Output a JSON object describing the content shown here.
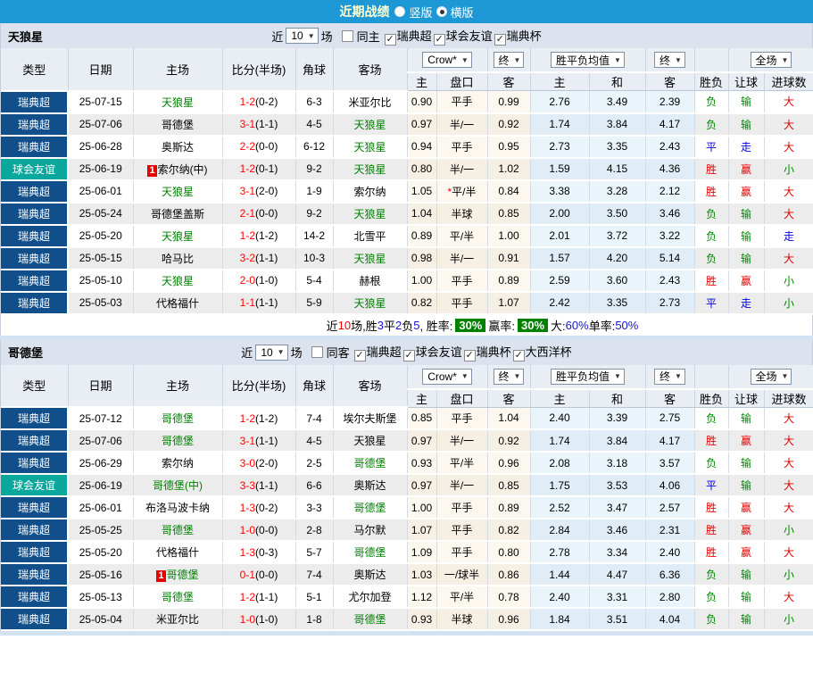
{
  "title_bar": {
    "title": "近期战绩",
    "options": [
      {
        "label": "竖版",
        "selected": false
      },
      {
        "label": "横版",
        "selected": true
      }
    ]
  },
  "filter_common": {
    "near_label": "近",
    "count": "10",
    "matches_label": "场"
  },
  "header": {
    "left_columns": [
      "类型",
      "日期",
      "主场",
      "比分(半场)",
      "角球",
      "客场"
    ],
    "groups": {
      "handicap_dropdown": "Crow*",
      "handicap_final": "终",
      "avg_dropdown": "胜平负均值",
      "avg_final": "终",
      "scope_dropdown": "全场"
    },
    "sub_columns": [
      "主",
      "盘口",
      "客",
      "主",
      "和",
      "客",
      "胜负",
      "让球",
      "进球数"
    ]
  },
  "result_colors": {
    "胜": "red",
    "赢": "red",
    "大": "red",
    "平": "blue",
    "走": "blue",
    "负": "green",
    "输": "green",
    "小": "green"
  },
  "colors": {
    "title_bar_blue": "#1e97d5",
    "league_navy": "#114f8b",
    "friendly_teal": "#0aa79d",
    "focus_team_green": "#008000",
    "score_red": "#ff0000",
    "rate_badge_green": "#008000"
  },
  "sections": [
    {
      "team": "天狼星",
      "same_option": {
        "label": "同主",
        "checked": false
      },
      "leagues": [
        {
          "label": "瑞典超",
          "checked": true
        },
        {
          "label": "球会友谊",
          "checked": true
        },
        {
          "label": "瑞典杯",
          "checked": true
        }
      ],
      "rows": [
        {
          "type": "瑞典超",
          "type_style": "league",
          "date": "25-07-15",
          "home": "天狼星",
          "home_focus": true,
          "home_badge": "",
          "score": "1-2",
          "half": "(0-2)",
          "corner": "6-3",
          "away": "米亚尔比",
          "away_focus": false,
          "odds": [
            "0.90",
            "平手",
            "0.99"
          ],
          "star": false,
          "avg": [
            "2.76",
            "3.49",
            "2.39"
          ],
          "results": [
            "负",
            "输",
            "大"
          ]
        },
        {
          "type": "瑞典超",
          "type_style": "league",
          "date": "25-07-06",
          "home": "哥德堡",
          "home_focus": false,
          "home_badge": "",
          "score": "3-1",
          "half": "(1-1)",
          "corner": "4-5",
          "away": "天狼星",
          "away_focus": true,
          "odds": [
            "0.97",
            "半/一",
            "0.92"
          ],
          "star": false,
          "avg": [
            "1.74",
            "3.84",
            "4.17"
          ],
          "results": [
            "负",
            "输",
            "大"
          ]
        },
        {
          "type": "瑞典超",
          "type_style": "league",
          "date": "25-06-28",
          "home": "奥斯达",
          "home_focus": false,
          "home_badge": "",
          "score": "2-2",
          "half": "(0-0)",
          "corner": "6-12",
          "away": "天狼星",
          "away_focus": true,
          "odds": [
            "0.94",
            "平手",
            "0.95"
          ],
          "star": false,
          "avg": [
            "2.73",
            "3.35",
            "2.43"
          ],
          "results": [
            "平",
            "走",
            "大"
          ]
        },
        {
          "type": "球会友谊",
          "type_style": "friendly",
          "date": "25-06-19",
          "home": "索尔纳(中)",
          "home_focus": false,
          "home_badge": "1",
          "score": "1-2",
          "half": "(0-1)",
          "corner": "9-2",
          "away": "天狼星",
          "away_focus": true,
          "odds": [
            "0.80",
            "半/一",
            "1.02"
          ],
          "star": false,
          "avg": [
            "1.59",
            "4.15",
            "4.36"
          ],
          "results": [
            "胜",
            "赢",
            "小"
          ]
        },
        {
          "type": "瑞典超",
          "type_style": "league",
          "date": "25-06-01",
          "home": "天狼星",
          "home_focus": true,
          "home_badge": "",
          "score": "3-1",
          "half": "(2-0)",
          "corner": "1-9",
          "away": "索尔纳",
          "away_focus": false,
          "odds": [
            "1.05",
            "平/半",
            "0.84"
          ],
          "star": true,
          "avg": [
            "3.38",
            "3.28",
            "2.12"
          ],
          "results": [
            "胜",
            "赢",
            "大"
          ]
        },
        {
          "type": "瑞典超",
          "type_style": "league",
          "date": "25-05-24",
          "home": "哥德堡盖斯",
          "home_focus": false,
          "home_badge": "",
          "score": "2-1",
          "half": "(0-0)",
          "corner": "9-2",
          "away": "天狼星",
          "away_focus": true,
          "odds": [
            "1.04",
            "半球",
            "0.85"
          ],
          "star": false,
          "avg": [
            "2.00",
            "3.50",
            "3.46"
          ],
          "results": [
            "负",
            "输",
            "大"
          ]
        },
        {
          "type": "瑞典超",
          "type_style": "league",
          "date": "25-05-20",
          "home": "天狼星",
          "home_focus": true,
          "home_badge": "",
          "score": "1-2",
          "half": "(1-2)",
          "corner": "14-2",
          "away": "北雪平",
          "away_focus": false,
          "odds": [
            "0.89",
            "平/半",
            "1.00"
          ],
          "star": false,
          "avg": [
            "2.01",
            "3.72",
            "3.22"
          ],
          "results": [
            "负",
            "输",
            "走"
          ]
        },
        {
          "type": "瑞典超",
          "type_style": "league",
          "date": "25-05-15",
          "home": "哈马比",
          "home_focus": false,
          "home_badge": "",
          "score": "3-2",
          "half": "(1-1)",
          "corner": "10-3",
          "away": "天狼星",
          "away_focus": true,
          "odds": [
            "0.98",
            "半/一",
            "0.91"
          ],
          "star": false,
          "avg": [
            "1.57",
            "4.20",
            "5.14"
          ],
          "results": [
            "负",
            "输",
            "大"
          ]
        },
        {
          "type": "瑞典超",
          "type_style": "league",
          "date": "25-05-10",
          "home": "天狼星",
          "home_focus": true,
          "home_badge": "",
          "score": "2-0",
          "half": "(1-0)",
          "corner": "5-4",
          "away": "赫根",
          "away_focus": false,
          "odds": [
            "1.00",
            "平手",
            "0.89"
          ],
          "star": false,
          "avg": [
            "2.59",
            "3.60",
            "2.43"
          ],
          "results": [
            "胜",
            "赢",
            "小"
          ]
        },
        {
          "type": "瑞典超",
          "type_style": "league",
          "date": "25-05-03",
          "home": "代格福什",
          "home_focus": false,
          "home_badge": "",
          "score": "1-1",
          "half": "(1-1)",
          "corner": "5-9",
          "away": "天狼星",
          "away_focus": true,
          "odds": [
            "0.82",
            "平手",
            "1.07"
          ],
          "star": false,
          "avg": [
            "2.42",
            "3.35",
            "2.73"
          ],
          "results": [
            "平",
            "走",
            "小"
          ]
        }
      ],
      "summary": [
        {
          "t": "近",
          "s": "k"
        },
        {
          "t": "10",
          "s": "r"
        },
        {
          "t": "场,胜",
          "s": "k"
        },
        {
          "t": "3",
          "s": "b"
        },
        {
          "t": "平",
          "s": "k"
        },
        {
          "t": "2",
          "s": "b"
        },
        {
          "t": "负",
          "s": "k"
        },
        {
          "t": "5",
          "s": "b"
        },
        {
          "t": ", 胜率:",
          "s": "k"
        },
        {
          "t": "30%",
          "s": "badge"
        },
        {
          "t": "赢率:",
          "s": "k"
        },
        {
          "t": "30%",
          "s": "badge"
        },
        {
          "t": "大:",
          "s": "k"
        },
        {
          "t": "60%",
          "s": "b"
        },
        {
          "t": " 单率:",
          "s": "k"
        },
        {
          "t": "50%",
          "s": "b"
        }
      ]
    },
    {
      "team": "哥德堡",
      "same_option": {
        "label": "同客",
        "checked": false
      },
      "leagues": [
        {
          "label": "瑞典超",
          "checked": true
        },
        {
          "label": "球会友谊",
          "checked": true
        },
        {
          "label": "瑞典杯",
          "checked": true
        },
        {
          "label": "大西洋杯",
          "checked": true
        }
      ],
      "rows": [
        {
          "type": "瑞典超",
          "type_style": "league",
          "date": "25-07-12",
          "home": "哥德堡",
          "home_focus": true,
          "home_badge": "",
          "score": "1-2",
          "half": "(1-2)",
          "corner": "7-4",
          "away": "埃尔夫斯堡",
          "away_focus": false,
          "odds": [
            "0.85",
            "平手",
            "1.04"
          ],
          "star": false,
          "avg": [
            "2.40",
            "3.39",
            "2.75"
          ],
          "results": [
            "负",
            "输",
            "大"
          ]
        },
        {
          "type": "瑞典超",
          "type_style": "league",
          "date": "25-07-06",
          "home": "哥德堡",
          "home_focus": true,
          "home_badge": "",
          "score": "3-1",
          "half": "(1-1)",
          "corner": "4-5",
          "away": "天狼星",
          "away_focus": false,
          "odds": [
            "0.97",
            "半/一",
            "0.92"
          ],
          "star": false,
          "avg": [
            "1.74",
            "3.84",
            "4.17"
          ],
          "results": [
            "胜",
            "赢",
            "大"
          ]
        },
        {
          "type": "瑞典超",
          "type_style": "league",
          "date": "25-06-29",
          "home": "索尔纳",
          "home_focus": false,
          "home_badge": "",
          "score": "3-0",
          "half": "(2-0)",
          "corner": "2-5",
          "away": "哥德堡",
          "away_focus": true,
          "odds": [
            "0.93",
            "平/半",
            "0.96"
          ],
          "star": false,
          "avg": [
            "2.08",
            "3.18",
            "3.57"
          ],
          "results": [
            "负",
            "输",
            "大"
          ]
        },
        {
          "type": "球会友谊",
          "type_style": "friendly",
          "date": "25-06-19",
          "home": "哥德堡(中)",
          "home_focus": true,
          "home_badge": "",
          "score": "3-3",
          "half": "(1-1)",
          "corner": "6-6",
          "away": "奥斯达",
          "away_focus": false,
          "odds": [
            "0.97",
            "半/一",
            "0.85"
          ],
          "star": false,
          "avg": [
            "1.75",
            "3.53",
            "4.06"
          ],
          "results": [
            "平",
            "输",
            "大"
          ]
        },
        {
          "type": "瑞典超",
          "type_style": "league",
          "date": "25-06-01",
          "home": "布洛马波卡纳",
          "home_focus": false,
          "home_badge": "",
          "score": "1-3",
          "half": "(0-2)",
          "corner": "3-3",
          "away": "哥德堡",
          "away_focus": true,
          "odds": [
            "1.00",
            "平手",
            "0.89"
          ],
          "star": false,
          "avg": [
            "2.52",
            "3.47",
            "2.57"
          ],
          "results": [
            "胜",
            "赢",
            "大"
          ]
        },
        {
          "type": "瑞典超",
          "type_style": "league",
          "date": "25-05-25",
          "home": "哥德堡",
          "home_focus": true,
          "home_badge": "",
          "score": "1-0",
          "half": "(0-0)",
          "corner": "2-8",
          "away": "马尔默",
          "away_focus": false,
          "odds": [
            "1.07",
            "平手",
            "0.82"
          ],
          "star": false,
          "avg": [
            "2.84",
            "3.46",
            "2.31"
          ],
          "results": [
            "胜",
            "赢",
            "小"
          ]
        },
        {
          "type": "瑞典超",
          "type_style": "league",
          "date": "25-05-20",
          "home": "代格福什",
          "home_focus": false,
          "home_badge": "",
          "score": "1-3",
          "half": "(0-3)",
          "corner": "5-7",
          "away": "哥德堡",
          "away_focus": true,
          "odds": [
            "1.09",
            "平手",
            "0.80"
          ],
          "star": false,
          "avg": [
            "2.78",
            "3.34",
            "2.40"
          ],
          "results": [
            "胜",
            "赢",
            "大"
          ]
        },
        {
          "type": "瑞典超",
          "type_style": "league",
          "date": "25-05-16",
          "home": "哥德堡",
          "home_focus": true,
          "home_badge": "1",
          "score": "0-1",
          "half": "(0-0)",
          "corner": "7-4",
          "away": "奥斯达",
          "away_focus": false,
          "odds": [
            "1.03",
            "一/球半",
            "0.86"
          ],
          "star": false,
          "avg": [
            "1.44",
            "4.47",
            "6.36"
          ],
          "results": [
            "负",
            "输",
            "小"
          ]
        },
        {
          "type": "瑞典超",
          "type_style": "league",
          "date": "25-05-13",
          "home": "哥德堡",
          "home_focus": true,
          "home_badge": "",
          "score": "1-2",
          "half": "(1-1)",
          "corner": "5-1",
          "away": "尤尔加登",
          "away_focus": false,
          "odds": [
            "1.12",
            "平/半",
            "0.78"
          ],
          "star": false,
          "avg": [
            "2.40",
            "3.31",
            "2.80"
          ],
          "results": [
            "负",
            "输",
            "大"
          ]
        },
        {
          "type": "瑞典超",
          "type_style": "league",
          "date": "25-05-04",
          "home": "米亚尔比",
          "home_focus": false,
          "home_badge": "",
          "score": "1-0",
          "half": "(1-0)",
          "corner": "1-8",
          "away": "哥德堡",
          "away_focus": true,
          "odds": [
            "0.93",
            "半球",
            "0.96"
          ],
          "star": false,
          "avg": [
            "1.84",
            "3.51",
            "4.04"
          ],
          "results": [
            "负",
            "输",
            "小"
          ]
        }
      ],
      "summary": null
    }
  ]
}
